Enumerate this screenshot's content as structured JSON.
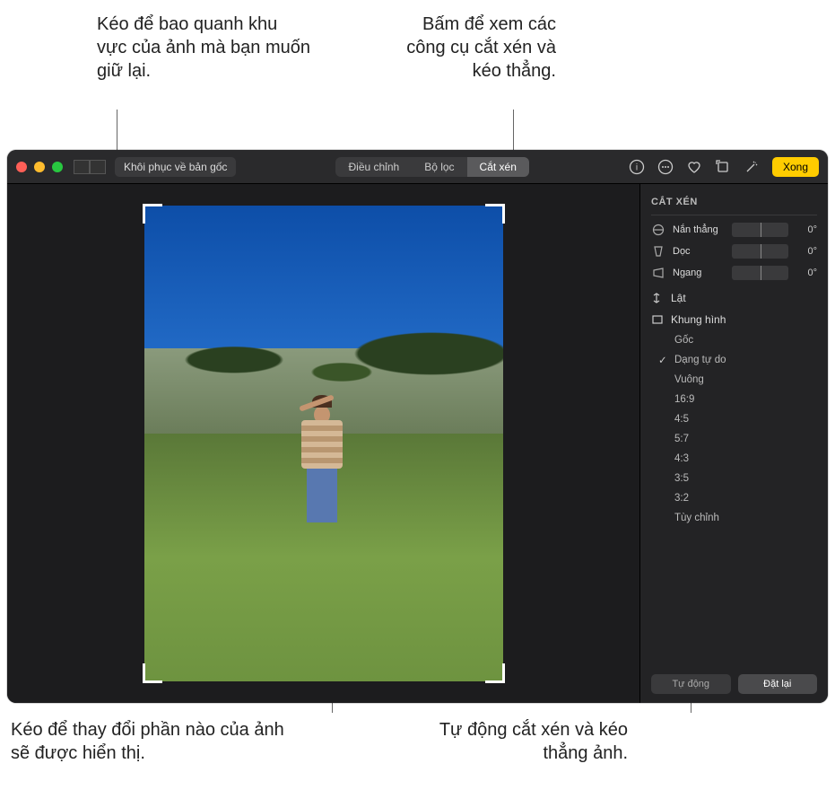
{
  "callouts": {
    "top_left": "Kéo để bao quanh khu vực của ảnh mà bạn muốn giữ lại.",
    "top_right": "Bấm để xem các công cụ cắt xén và kéo thẳng.",
    "bottom_left": "Kéo để thay đổi phần nào của ảnh sẽ được hiển thị.",
    "bottom_right": "Tự động cắt xén và kéo thẳng ảnh."
  },
  "toolbar": {
    "revert": "Khôi phục về bản gốc",
    "tabs": {
      "adjust": "Điều chỉnh",
      "filters": "Bộ lọc",
      "crop": "Cắt xén"
    },
    "done": "Xong"
  },
  "sidebar": {
    "title": "CẮT XÉN",
    "sliders": {
      "straighten": {
        "label": "Nắn thẳng",
        "value": "0°"
      },
      "vertical": {
        "label": "Dọc",
        "value": "0°"
      },
      "horizontal": {
        "label": "Ngang",
        "value": "0°"
      }
    },
    "flip": "Lật",
    "aspect_header": "Khung hình",
    "aspects": [
      "Gốc",
      "Dạng tự do",
      "Vuông",
      "16:9",
      "4:5",
      "5:7",
      "4:3",
      "3:5",
      "3:2",
      "Tùy chỉnh"
    ],
    "selected_aspect": "Dạng tự do",
    "footer": {
      "auto": "Tự động",
      "reset": "Đặt lại"
    }
  }
}
